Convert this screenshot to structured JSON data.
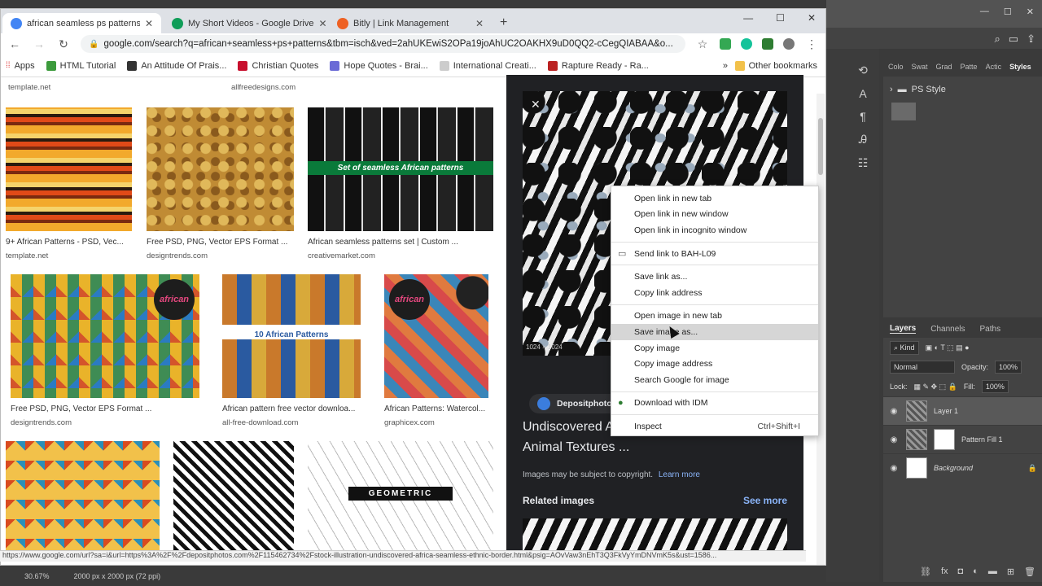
{
  "chrome": {
    "tabs": [
      {
        "label": "african seamless ps patterns - Go",
        "close": "✕",
        "color": "#4285f4"
      },
      {
        "label": "My Short Videos - Google Drive",
        "close": "✕",
        "color": "#0f9d58"
      },
      {
        "label": "Bitly | Link Management",
        "close": "✕",
        "color": "#ee6123"
      }
    ],
    "new_tab": "+",
    "window_controls": [
      "—",
      "☐",
      "✕"
    ],
    "url": "google.com/search?q=african+seamless+ps+patterns&tbm=isch&ved=2ahUKEwiS2OPa19joAhUC2OAKHX9uD0QQ2-cCegQIABAA&o...",
    "bookmarks": [
      {
        "label": "Apps",
        "color": "#666"
      },
      {
        "label": "HTML Tutorial",
        "color": "#3c9b3c"
      },
      {
        "label": "An Attitude Of Prais...",
        "color": "#333"
      },
      {
        "label": "Christian Quotes",
        "color": "#c8102e"
      },
      {
        "label": "Hope Quotes - Brai...",
        "color": "#6b6bd6"
      },
      {
        "label": "International Creati...",
        "color": "#666"
      },
      {
        "label": "Rapture Ready - Ra...",
        "color": "#b22"
      }
    ],
    "bookmarks_more": "»",
    "other_bookmarks": "Other bookmarks"
  },
  "results": {
    "top_sources": [
      "template.net",
      "allfreedesigns.com"
    ],
    "cards": [
      {
        "title": "9+ African Patterns - PSD, Vec...",
        "src": "template.net"
      },
      {
        "title": "Free PSD, PNG, Vector EPS Format ...",
        "src": "designtrends.com"
      },
      {
        "title": "African seamless patterns set | Custom ...",
        "src": "creativemarket.com",
        "overlay": "Set of seamless African patterns"
      },
      {
        "title": "Free PSD, PNG, Vector EPS Format ...",
        "src": "designtrends.com",
        "overlay": "african"
      },
      {
        "title": "African pattern free vector downloa...",
        "src": "all-free-download.com",
        "overlay": "10 African Patterns"
      },
      {
        "title": "African Patterns: Watercol...",
        "src": "graphicex.com",
        "overlay": "african"
      },
      {
        "title": "",
        "src": ""
      },
      {
        "title": "",
        "src": ""
      },
      {
        "title": "",
        "src": "",
        "overlay": "GEOMETRIC"
      }
    ]
  },
  "preview": {
    "dimensions": "1024 × 1024",
    "source": "Depositphotos",
    "title": "Undiscovered Africa. Seamless Ethnic Border. Animal Textures ...",
    "copyright": "Images may be subject to copyright.",
    "learn_more": "Learn more",
    "related": "Related images",
    "see_more": "See more"
  },
  "context_menu": {
    "group1": [
      "Open link in new tab",
      "Open link in new window",
      "Open link in incognito window"
    ],
    "send": "Send link to BAH-L09",
    "group2": [
      "Save link as...",
      "Copy link address"
    ],
    "group3": [
      "Open image in new tab",
      "Save image as...",
      "Copy image",
      "Copy image address",
      "Search Google for image"
    ],
    "idm": "Download with IDM",
    "inspect": "Inspect",
    "inspect_shortcut": "Ctrl+Shift+I"
  },
  "status_url": "https://www.google.com/url?sa=i&url=https%3A%2F%2Fdepositphotos.com%2F115462734%2Fstock-illustration-undiscovered-africa-seamless-ethnic-border.html&psig=AOvVaw3nEhT3Q3FkVyYmDNVmK5s&ust=1586...",
  "photoshop": {
    "style_tabs": [
      "Colo",
      "Swat",
      "Grad",
      "Patte",
      "Actic",
      "Styles"
    ],
    "style_folder": "PS Style",
    "layer_tabs": [
      "Layers",
      "Channels",
      "Paths"
    ],
    "kind": "Kind",
    "blend_mode": "Normal",
    "opacity_label": "Opacity:",
    "opacity_value": "100%",
    "lock_label": "Lock:",
    "fill_label": "Fill:",
    "fill_value": "100%",
    "layers": [
      {
        "name": "Layer 1"
      },
      {
        "name": "Pattern Fill 1"
      },
      {
        "name": "Background"
      }
    ],
    "status_zoom": "30.67%",
    "status_doc": "2000 px x 2000 px (72 ppi)"
  }
}
